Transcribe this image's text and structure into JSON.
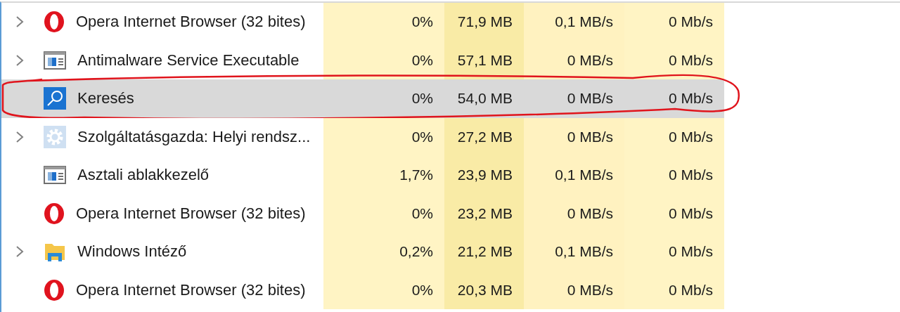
{
  "processes": [
    {
      "name": "Opera Internet Browser (32 bites)",
      "icon": {
        "kind": "opera"
      },
      "expandable": true,
      "selected": false,
      "circled": false,
      "cpu": "0%",
      "memory": "71,9 MB",
      "disk": "0,1 MB/s",
      "network": "0 Mb/s"
    },
    {
      "name": "Antimalware Service Executable",
      "icon": {
        "kind": "window"
      },
      "expandable": true,
      "selected": false,
      "circled": false,
      "cpu": "0%",
      "memory": "57,1 MB",
      "disk": "0 MB/s",
      "network": "0 Mb/s"
    },
    {
      "name": "Keresés",
      "icon": {
        "kind": "search"
      },
      "expandable": false,
      "selected": true,
      "circled": true,
      "cpu": "0%",
      "memory": "54,0 MB",
      "disk": "0 MB/s",
      "network": "0 Mb/s"
    },
    {
      "name": "Szolgáltatásgazda: Helyi rendsz...",
      "icon": {
        "kind": "gear"
      },
      "expandable": true,
      "selected": false,
      "circled": false,
      "cpu": "0%",
      "memory": "27,2 MB",
      "disk": "0 MB/s",
      "network": "0 Mb/s"
    },
    {
      "name": "Asztali ablakkezelő",
      "icon": {
        "kind": "window"
      },
      "expandable": false,
      "selected": false,
      "circled": false,
      "cpu": "1,7%",
      "memory": "23,9 MB",
      "disk": "0,1 MB/s",
      "network": "0 Mb/s"
    },
    {
      "name": "Opera Internet Browser (32 bites)",
      "icon": {
        "kind": "opera"
      },
      "expandable": false,
      "selected": false,
      "circled": false,
      "cpu": "0%",
      "memory": "23,2 MB",
      "disk": "0 MB/s",
      "network": "0 Mb/s"
    },
    {
      "name": "Windows Intéző",
      "icon": {
        "kind": "folder"
      },
      "expandable": true,
      "selected": false,
      "circled": false,
      "cpu": "0,2%",
      "memory": "21,2 MB",
      "disk": "0,1 MB/s",
      "network": "0 Mb/s"
    },
    {
      "name": "Opera Internet Browser (32 bites)",
      "icon": {
        "kind": "opera"
      },
      "expandable": false,
      "selected": false,
      "circled": false,
      "cpu": "0%",
      "memory": "20,3 MB",
      "disk": "0 MB/s",
      "network": "0 Mb/s"
    }
  ]
}
